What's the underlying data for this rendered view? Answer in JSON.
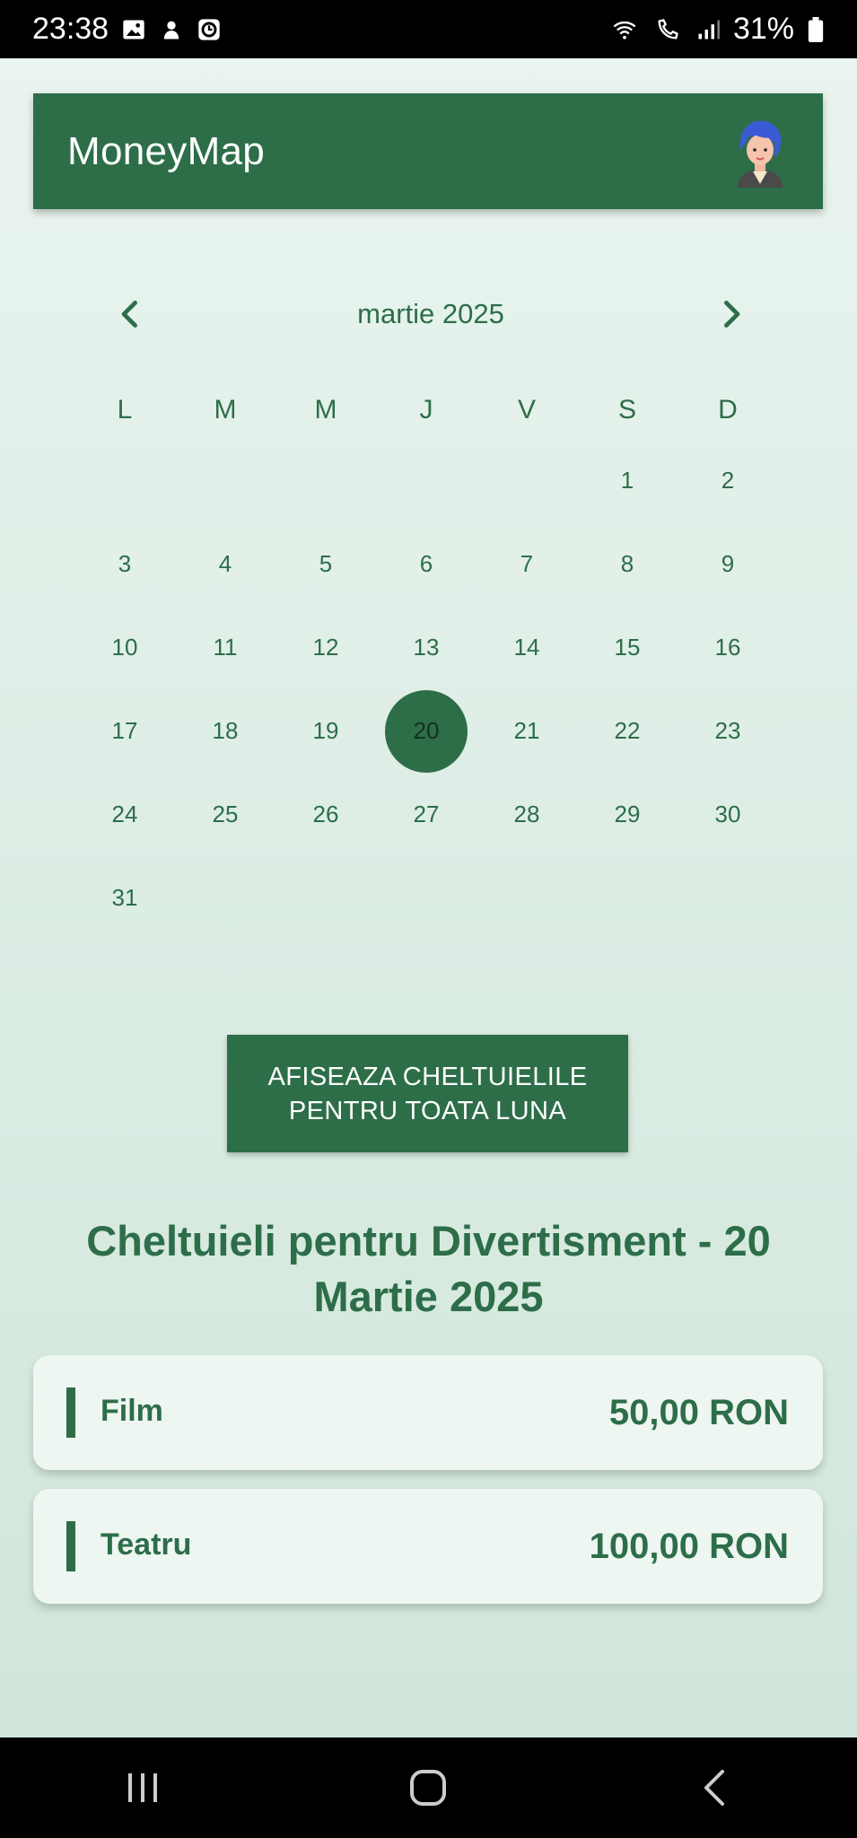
{
  "status_bar": {
    "time": "23:38",
    "battery": "31%",
    "left_icons": [
      "gallery-icon",
      "notification-icon",
      "clock-app-icon"
    ],
    "right_icons": [
      "wifi-icon",
      "wifi-calling-icon",
      "signal-icon",
      "battery-icon"
    ]
  },
  "app_bar": {
    "title": "MoneyMap",
    "avatar_icon": "avatar-icon"
  },
  "calendar": {
    "month_label": "martie 2025",
    "prev_icon": "chevron-left-icon",
    "next_icon": "chevron-right-icon",
    "weekdays": [
      "L",
      "M",
      "M",
      "J",
      "V",
      "S",
      "D"
    ],
    "leading_blanks": 5,
    "days": [
      "1",
      "2",
      "3",
      "4",
      "5",
      "6",
      "7",
      "8",
      "9",
      "10",
      "11",
      "12",
      "13",
      "14",
      "15",
      "16",
      "17",
      "18",
      "19",
      "20",
      "21",
      "22",
      "23",
      "24",
      "25",
      "26",
      "27",
      "28",
      "29",
      "30",
      "31"
    ],
    "selected_day": "20"
  },
  "month_button": {
    "line1": "AFISEAZA CHELTUIELILE",
    "line2": "PENTRU TOATA LUNA"
  },
  "section": {
    "title_line1": "Cheltuieli pentru Divertisment - 20",
    "title_line2": "Martie 2025"
  },
  "expenses": [
    {
      "name": "Film",
      "amount": "50,00 RON"
    },
    {
      "name": "Teatru",
      "amount": "100,00 RON"
    }
  ],
  "nav_bar": {
    "icons": [
      "recent-apps-icon",
      "home-icon",
      "back-icon"
    ]
  },
  "colors": {
    "primary": "#2d6e49",
    "card_bg": "#eef6f2",
    "selected_text": "#14301f"
  }
}
